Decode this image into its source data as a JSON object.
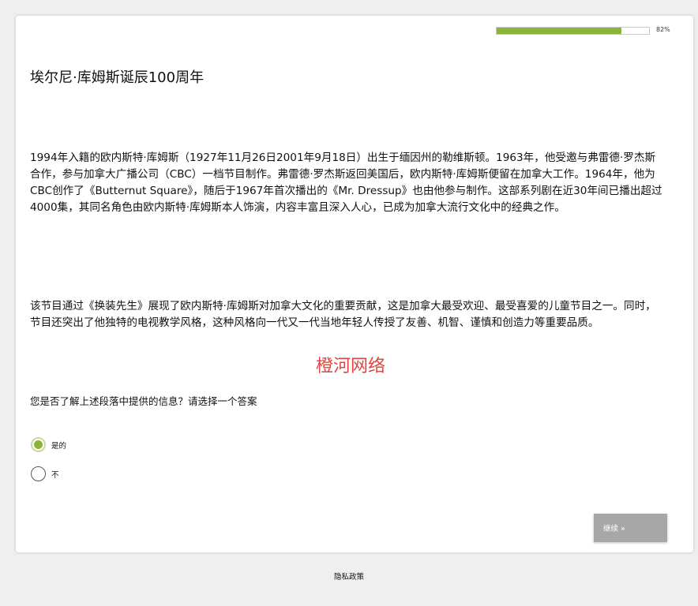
{
  "progress": {
    "value": 0.82,
    "label": "82%",
    "fill_color": "#8cb43a"
  },
  "article": {
    "title": "埃尔尼·库姆斯诞辰100周年",
    "paragraph_1": "1994年入籍的欧内斯特·库姆斯（1927年11月26日2001年9月18日）出生于缅因州的勒维斯顿。1963年，他受邀与弗雷德·罗杰斯合作，参与加拿大广播公司（CBC）一档节目制作。弗雷德·罗杰斯返回美国后，欧内斯特·库姆斯便留在加拿大工作。1964年，他为CBC创作了《Butternut Square》，随后于1967年首次播出的《Mr. Dressup》也由他参与制作。这部系列剧在近30年间已播出超过4000集，其同名角色由欧内斯特·库姆斯本人饰演，内容丰富且深入人心，已成为加拿大流行文化中的经典之作。",
    "paragraph_2": "该节目通过《换装先生》展现了欧内斯特·库姆斯对加拿大文化的重要贡献，这是加拿大最受欢迎、最受喜爱的儿童节目之一。同时，节目还突出了他独特的电视教学风格，这种风格向一代又一代当地年轻人传授了友善、机智、谨慎和创造力等重要品质。"
  },
  "watermark": {
    "text": "橙河网络",
    "color": "#e0453f"
  },
  "question": {
    "text": "您是否了解上述段落中提供的信息？请选择一个答案",
    "options": [
      {
        "label": "是的",
        "selected": true
      },
      {
        "label": "不",
        "selected": false
      }
    ]
  },
  "continue_button": {
    "label": "继续 »",
    "color": "#a7a7a7"
  },
  "footer": {
    "privacy_label": "隐私政策"
  }
}
